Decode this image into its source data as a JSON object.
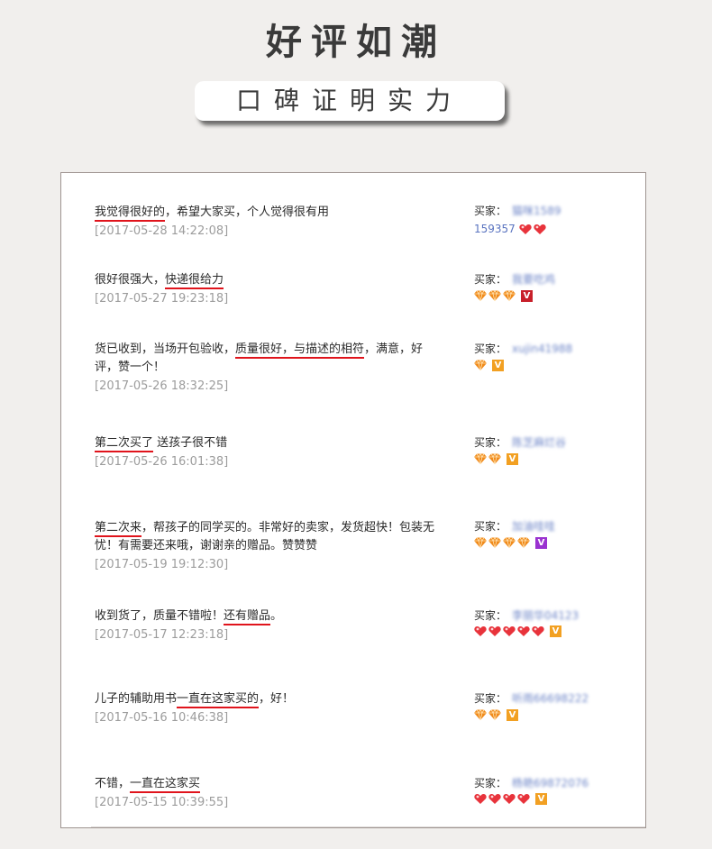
{
  "header": {
    "title": "好评如潮",
    "subtitle": "口碑证明实力"
  },
  "colors": {
    "underline": "#e0141c",
    "heart": "#e8333b",
    "diamond": "#f08a1a",
    "level_red": "#c8202a",
    "level_orange": "#f2a022",
    "level_purple": "#9a32d0"
  },
  "reviews": [
    {
      "segments": [
        {
          "text": "我觉得很好的",
          "u": true
        },
        {
          "text": "，希望大家买，个人觉得很有用",
          "u": false
        }
      ],
      "date": "[2017-05-28 14:22:08]",
      "buyer_label": "买家：",
      "buyer_name": "猫咪1589",
      "buyer_name_line2": "159357",
      "badges": {
        "type": "heart",
        "count": 2
      },
      "level": null
    },
    {
      "segments": [
        {
          "text": "很好很强大，",
          "u": false
        },
        {
          "text": "快递很给力",
          "u": true
        }
      ],
      "date": "[2017-05-27 19:23:18]",
      "buyer_label": "买家：",
      "buyer_name": "我要吃鸡",
      "badges": {
        "type": "diamond",
        "count": 3
      },
      "level": {
        "color": "red",
        "glyph": "V"
      }
    },
    {
      "segments": [
        {
          "text": "货已收到，当场开包验收，",
          "u": false
        },
        {
          "text": "质量很好，与描述的相符",
          "u": true
        },
        {
          "text": "，满意，好评，赞一个！",
          "u": false
        }
      ],
      "date": "[2017-05-26 18:32:25]",
      "buyer_label": "买家：",
      "buyer_name": "xujin41988",
      "badges": {
        "type": "diamond",
        "count": 1
      },
      "level": {
        "color": "orange",
        "glyph": "V"
      }
    },
    {
      "segments": [
        {
          "text": "第二次买了",
          "u": true
        },
        {
          "text": " 送孩子很不错",
          "u": false
        }
      ],
      "date": "[2017-05-26 16:01:38]",
      "buyer_label": "买家：",
      "buyer_name": "陈芝麻烂谷",
      "badges": {
        "type": "diamond",
        "count": 2
      },
      "level": {
        "color": "orange",
        "glyph": "V"
      }
    },
    {
      "segments": [
        {
          "text": "第二次来",
          "u": true
        },
        {
          "text": "，帮孩子的同学买的。非常好的卖家，发货超快！包装无忧！有需要还来哦，谢谢亲的赠品。赞赞赞",
          "u": false
        }
      ],
      "date": "[2017-05-19 19:12:30]",
      "buyer_label": "买家：",
      "buyer_name": "加油哇哇",
      "badges": {
        "type": "diamond",
        "count": 4
      },
      "level": {
        "color": "purple",
        "glyph": "V"
      }
    },
    {
      "segments": [
        {
          "text": "收到货了，质量不错啦！",
          "u": false
        },
        {
          "text": "还有赠品",
          "u": true
        },
        {
          "text": "。",
          "u": false
        }
      ],
      "date": "[2017-05-17 12:23:18]",
      "buyer_label": "买家：",
      "buyer_name": "李丽华04123",
      "badges": {
        "type": "heart",
        "count": 5
      },
      "level": {
        "color": "orange",
        "glyph": "V"
      }
    },
    {
      "segments": [
        {
          "text": "儿子的辅助用书",
          "u": false
        },
        {
          "text": "一直在这家买的",
          "u": true
        },
        {
          "text": "，好！",
          "u": false
        }
      ],
      "date": "[2017-05-16 10:46:38]",
      "buyer_label": "买家：",
      "buyer_name": "听雨66698222",
      "badges": {
        "type": "diamond",
        "count": 2
      },
      "level": {
        "color": "orange",
        "glyph": "V"
      }
    },
    {
      "segments": [
        {
          "text": "不错，",
          "u": false
        },
        {
          "text": "一直在这家买",
          "u": true
        }
      ],
      "date": "[2017-05-15 10:39:55]",
      "buyer_label": "买家：",
      "buyer_name": "杨艳69872076",
      "badges": {
        "type": "heart",
        "count": 4
      },
      "level": {
        "color": "orange",
        "glyph": "V"
      }
    }
  ]
}
